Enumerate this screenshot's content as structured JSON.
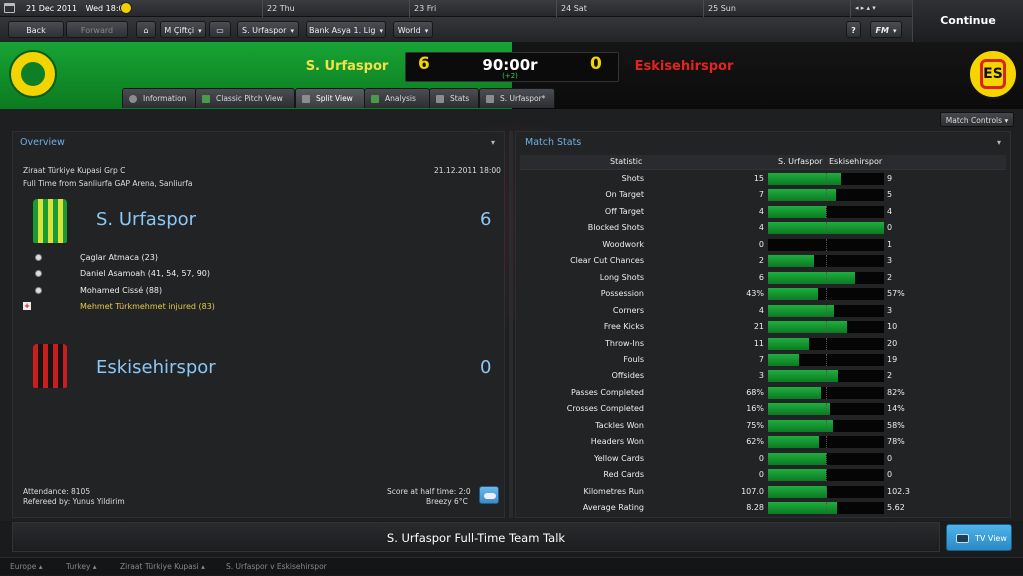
{
  "topbar": {
    "date": "21 Dec 2011",
    "day_time": "Wed 18:00",
    "days": [
      "22 Thu",
      "23 Fri",
      "24 Sat",
      "25 Sun"
    ],
    "continue_label": "Continue"
  },
  "nav": {
    "back": "Back",
    "forward": "Forward",
    "manager": "M Çiftçi",
    "club": "S. Urfaspor",
    "league": "Bank Asya 1. Lig",
    "world": "World",
    "help": "?",
    "fm": "FM"
  },
  "match": {
    "home": "S. Urfaspor",
    "away": "Eskisehirspor",
    "home_score": "6",
    "away_score": "0",
    "clock": "90:00r",
    "added": "(+2)",
    "home_color": "#1fae3e",
    "away_color": "#e02020"
  },
  "tabs": [
    {
      "label": "Information",
      "icon": "info-icon"
    },
    {
      "label": "Classic Pitch View",
      "icon": "pitch-icon"
    },
    {
      "label": "Split View",
      "icon": "split-icon"
    },
    {
      "label": "Analysis",
      "icon": "analysis-icon"
    },
    {
      "label": "Stats",
      "icon": "stats-icon"
    },
    {
      "label": "S. Urfaspor*",
      "icon": "tactics-icon"
    }
  ],
  "match_controls": "Match Controls",
  "overview": {
    "title": "Overview",
    "competition": "Ziraat Türkiye Kupasi Grp C",
    "venue": "Full Time from Sanliurfa GAP Arena, Sanliurfa",
    "datetime": "21.12.2011 18:00",
    "home_name": "S. Urfaspor",
    "home_score": "6",
    "away_name": "Eskisehirspor",
    "away_score": "0",
    "events": [
      {
        "text": "Çaglar Atmaca (23)",
        "type": "goal"
      },
      {
        "text": "Daniel Asamoah (41, 54, 57, 90)",
        "type": "goal"
      },
      {
        "text": "Mohamed Cissé (88)",
        "type": "goal"
      },
      {
        "text": "Mehmet Türkmehmet injured (83)",
        "type": "injury"
      }
    ],
    "attendance": "Attendance: 8105",
    "referee": "Refereed by: Yunus Yildirim",
    "halftime": "Score at half time: 2:0",
    "weather": "Breezy 6°C"
  },
  "stats": {
    "title": "Match Stats",
    "col_stat": "Statistic",
    "col_home": "S. Urfaspor",
    "col_away": "Eskisehirspor",
    "rows": [
      {
        "label": "Shots",
        "home": "15",
        "away": "9",
        "share": 0.625
      },
      {
        "label": "On Target",
        "home": "7",
        "away": "5",
        "share": 0.583
      },
      {
        "label": "Off Target",
        "home": "4",
        "away": "4",
        "share": 0.5
      },
      {
        "label": "Blocked Shots",
        "home": "4",
        "away": "0",
        "share": 1.0
      },
      {
        "label": "Woodwork",
        "home": "0",
        "away": "1",
        "share": 0.0
      },
      {
        "label": "Clear Cut Chances",
        "home": "2",
        "away": "3",
        "share": 0.4
      },
      {
        "label": "Long Shots",
        "home": "6",
        "away": "2",
        "share": 0.75
      },
      {
        "label": "Possession",
        "home": "43%",
        "away": "57%",
        "share": 0.43
      },
      {
        "label": "Corners",
        "home": "4",
        "away": "3",
        "share": 0.571
      },
      {
        "label": "Free Kicks",
        "home": "21",
        "away": "10",
        "share": 0.677
      },
      {
        "label": "Throw-Ins",
        "home": "11",
        "away": "20",
        "share": 0.355
      },
      {
        "label": "Fouls",
        "home": "7",
        "away": "19",
        "share": 0.269
      },
      {
        "label": "Offsides",
        "home": "3",
        "away": "2",
        "share": 0.6
      },
      {
        "label": "Passes Completed",
        "home": "68%",
        "away": "82%",
        "share": 0.453
      },
      {
        "label": "Crosses Completed",
        "home": "16%",
        "away": "14%",
        "share": 0.533
      },
      {
        "label": "Tackles Won",
        "home": "75%",
        "away": "58%",
        "share": 0.564
      },
      {
        "label": "Headers Won",
        "home": "62%",
        "away": "78%",
        "share": 0.443
      },
      {
        "label": "Yellow Cards",
        "home": "0",
        "away": "0",
        "share": 0.5
      },
      {
        "label": "Red Cards",
        "home": "0",
        "away": "0",
        "share": 0.5
      },
      {
        "label": "Kilometres Run",
        "home": "107.0",
        "away": "102.3",
        "share": 0.511
      },
      {
        "label": "Average Rating",
        "home": "8.28",
        "away": "5.62",
        "share": 0.596
      }
    ]
  },
  "team_talk": "S. Urfaspor Full-Time Team Talk",
  "tv_view": "TV View",
  "breadcrumbs": [
    "Europe",
    "Turkey",
    "Ziraat Türkiye Kupasi",
    "S. Urfaspor v Eskisehirspor"
  ]
}
